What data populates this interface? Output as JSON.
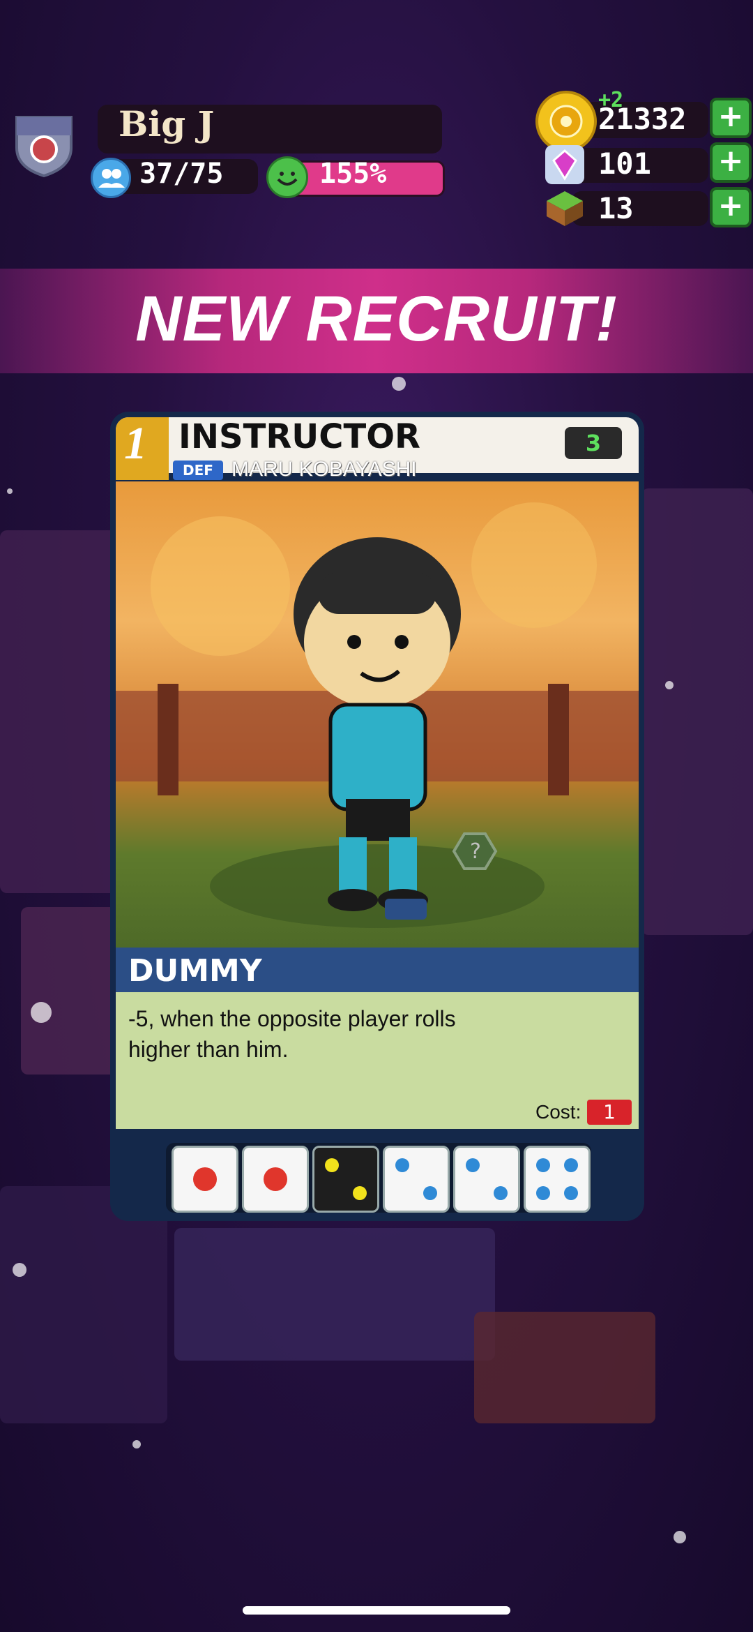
{
  "player": {
    "name": "Big J",
    "roster": "37/75",
    "happiness": "155%"
  },
  "currency": {
    "coins": "21332",
    "coins_delta": "+2",
    "gems": "101",
    "blocks": "13"
  },
  "banner": {
    "title": "NEW RECRUIT!"
  },
  "card": {
    "level": "1",
    "name": "INSTRUCTOR",
    "position": "DEF",
    "player_name": "MARU KOBAYASHI",
    "rating": "3",
    "ability": {
      "title": "DUMMY",
      "description": "-5, when the opposite player rolls higher than him.",
      "cost_label": "Cost:",
      "cost_value": "1"
    },
    "dice": [
      {
        "face": "red-1",
        "value": 1,
        "color": "#e0362c"
      },
      {
        "face": "red-1",
        "value": 1,
        "color": "#e0362c"
      },
      {
        "face": "yellow-2",
        "value": 2,
        "color": "#f2e21c"
      },
      {
        "face": "blue-2",
        "value": 2,
        "color": "#2f8ad6"
      },
      {
        "face": "blue-2",
        "value": 2,
        "color": "#2f8ad6"
      },
      {
        "face": "blue-4",
        "value": 4,
        "color": "#2f8ad6"
      }
    ]
  },
  "colors": {
    "banner": "#cf2f8a",
    "card_frame": "#14284a",
    "ability_bar": "#2b4e86",
    "desc_bg": "#c9dca0",
    "plus_button": "#3cb043"
  }
}
